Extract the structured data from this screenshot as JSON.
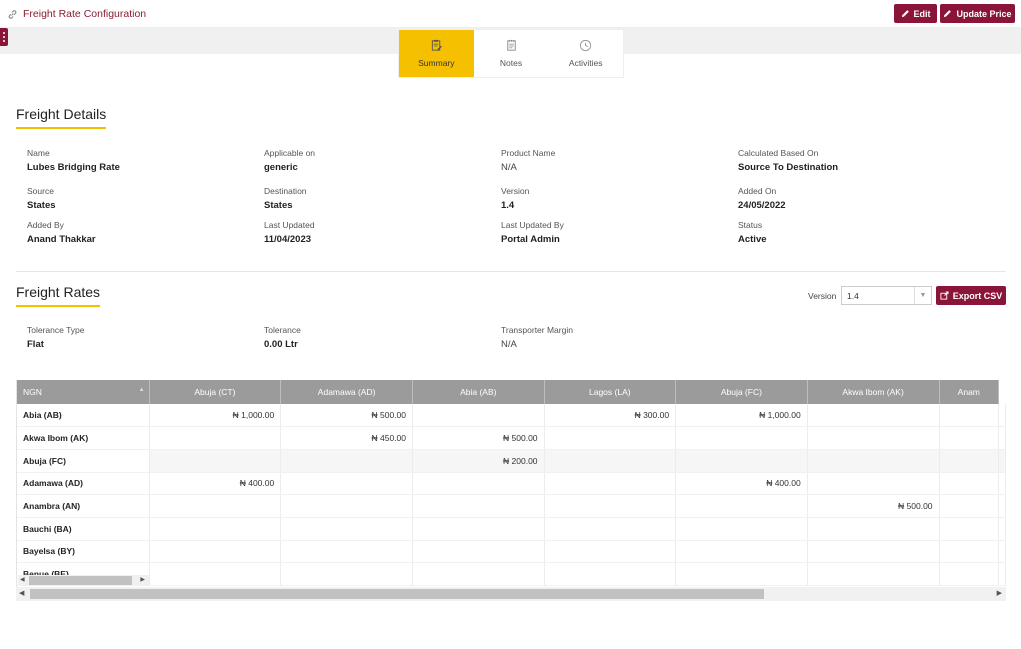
{
  "header": {
    "title": "Freight Rate Configuration",
    "edit_label": "Edit",
    "update_price_label": "Update Price"
  },
  "tabs": [
    {
      "label": "Summary",
      "icon": "clipboard-edit-icon",
      "active": true
    },
    {
      "label": "Notes",
      "icon": "notes-icon",
      "active": false
    },
    {
      "label": "Activities",
      "icon": "clock-icon",
      "active": false
    }
  ],
  "freight_details": {
    "title": "Freight Details",
    "fields": [
      {
        "label": "Name",
        "value": "Lubes Bridging Rate"
      },
      {
        "label": "Applicable on",
        "value": "generic"
      },
      {
        "label": "Product Name",
        "value": "N/A"
      },
      {
        "label": "Calculated Based On",
        "value": "Source To Destination"
      },
      {
        "label": "Source",
        "value": "States"
      },
      {
        "label": "Destination",
        "value": "States"
      },
      {
        "label": "Version",
        "value": "1.4"
      },
      {
        "label": "Added On",
        "value": "24/05/2022"
      },
      {
        "label": "Added By",
        "value": "Anand Thakkar"
      },
      {
        "label": "Last Updated",
        "value": "11/04/2023"
      },
      {
        "label": "Last Updated By",
        "value": "Portal Admin"
      },
      {
        "label": "Status",
        "value": "Active"
      }
    ]
  },
  "freight_rates": {
    "title": "Freight Rates",
    "version_label": "Version",
    "version_value": "1.4",
    "export_label": "Export CSV",
    "fields": [
      {
        "label": "Tolerance Type",
        "value": "Flat"
      },
      {
        "label": "Tolerance",
        "value": "0.00 Ltr"
      },
      {
        "label": "Transporter Margin",
        "value": "N/A"
      }
    ],
    "grid": {
      "corner": "NGN",
      "columns": [
        "Abuja (CT)",
        "Adamawa (AD)",
        "Abia (AB)",
        "Lagos (LA)",
        "Abuja (FC)",
        "Akwa Ibom (AK)",
        "Anam"
      ],
      "rows": [
        {
          "name": "Abia (AB)",
          "cells": [
            "₦ 1,000.00",
            "₦ 500.00",
            "",
            "₦ 300.00",
            "₦ 1,000.00",
            "",
            ""
          ]
        },
        {
          "name": "Akwa Ibom (AK)",
          "cells": [
            "",
            "₦ 450.00",
            "₦ 500.00",
            "",
            "",
            "",
            ""
          ]
        },
        {
          "name": "Abuja (FC)",
          "cells": [
            "",
            "",
            "₦ 200.00",
            "",
            "",
            "",
            ""
          ]
        },
        {
          "name": "Adamawa (AD)",
          "cells": [
            "₦ 400.00",
            "",
            "",
            "",
            "₦ 400.00",
            "",
            ""
          ]
        },
        {
          "name": "Anambra (AN)",
          "cells": [
            "",
            "",
            "",
            "",
            "",
            "₦ 500.00",
            ""
          ]
        },
        {
          "name": "Bauchi (BA)",
          "cells": [
            "",
            "",
            "",
            "",
            "",
            "",
            ""
          ]
        },
        {
          "name": "Bayelsa (BY)",
          "cells": [
            "",
            "",
            "",
            "",
            "",
            "",
            ""
          ]
        },
        {
          "name": "Benue (BE)",
          "cells": [
            "",
            "",
            "",
            "",
            "",
            "",
            ""
          ]
        }
      ]
    }
  }
}
